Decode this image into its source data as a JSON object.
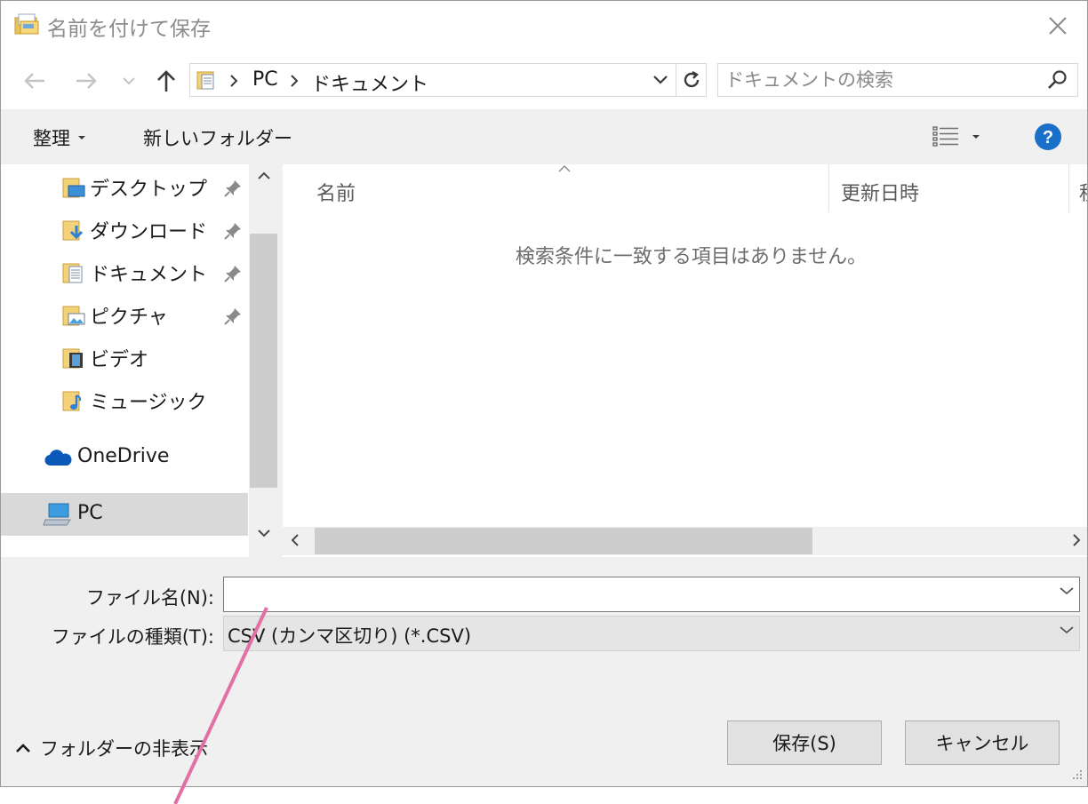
{
  "window": {
    "title": "名前を付けて保存"
  },
  "address": {
    "crumbs": [
      "PC",
      "ドキュメント"
    ]
  },
  "search": {
    "placeholder": "ドキュメントの検索"
  },
  "toolbar": {
    "organize_label": "整理",
    "new_folder_label": "新しいフォルダー"
  },
  "nav": {
    "quick_access": [
      {
        "label": "デスクトップ",
        "icon": "desktop-folder-icon",
        "pinned": true
      },
      {
        "label": "ダウンロード",
        "icon": "downloads-folder-icon",
        "pinned": true
      },
      {
        "label": "ドキュメント",
        "icon": "documents-folder-icon",
        "pinned": true
      },
      {
        "label": "ピクチャ",
        "icon": "pictures-folder-icon",
        "pinned": true
      },
      {
        "label": "ビデオ",
        "icon": "videos-folder-icon",
        "pinned": false
      },
      {
        "label": "ミュージック",
        "icon": "music-folder-icon",
        "pinned": false
      }
    ],
    "onedrive_label": "OneDrive",
    "pc_label": "PC"
  },
  "columns": {
    "name": "名前",
    "modified": "更新日時",
    "type_partial": "種"
  },
  "empty_message": "検索条件に一致する項目はありません。",
  "form": {
    "filename_label": "ファイル名(N):",
    "filename_value": "",
    "filetype_label": "ファイルの種類(T):",
    "filetype_value": "CSV (カンマ区切り) (*.CSV)"
  },
  "footer": {
    "hide_folders_label": "フォルダーの非表示",
    "save_label": "保存(S)",
    "cancel_label": "キャンセル"
  },
  "colors": {
    "help_blue": "#1a6fc9",
    "selected_bg": "#d9d9d9",
    "annotation_line": "#e36fa8"
  }
}
